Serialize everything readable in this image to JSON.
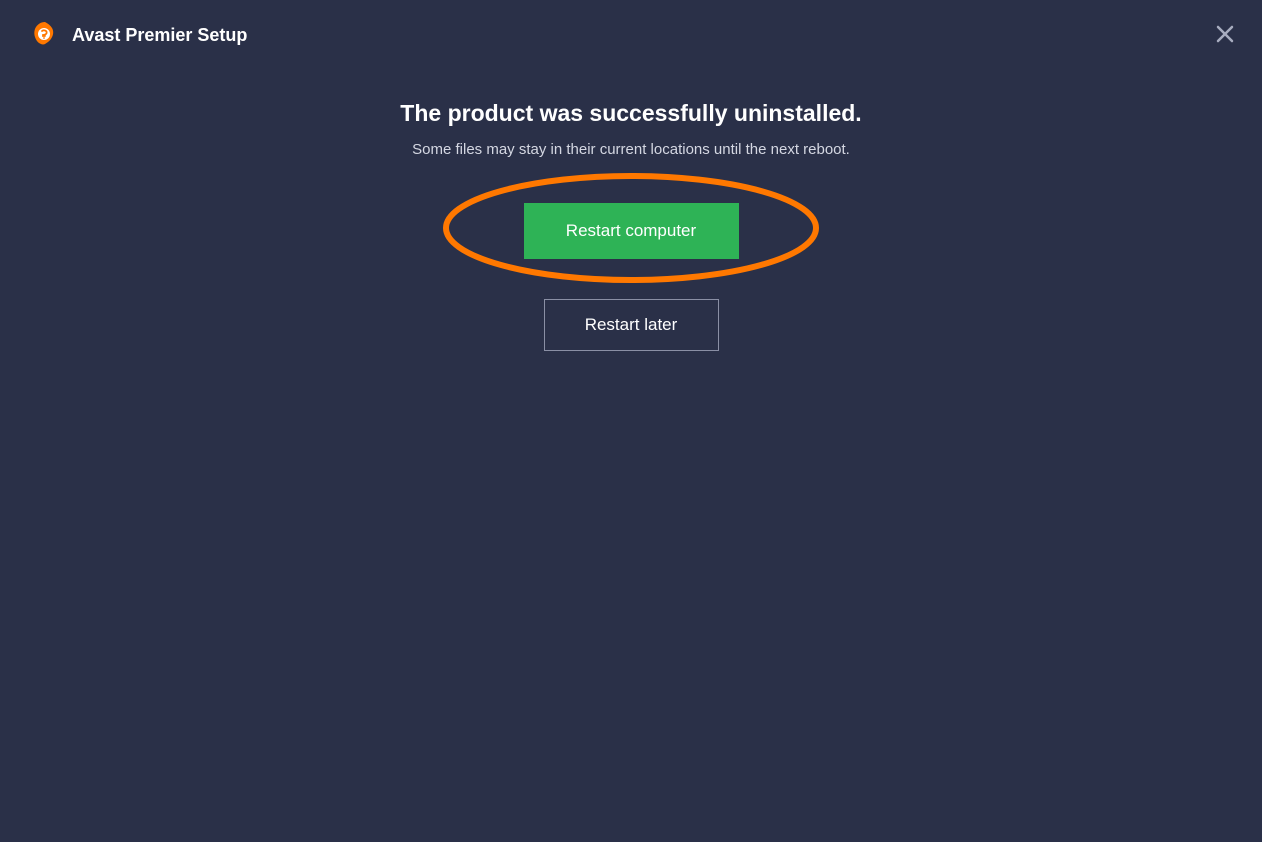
{
  "header": {
    "title": "Avast Premier Setup"
  },
  "main": {
    "heading": "The product was successfully uninstalled.",
    "sub_text": "Some files may stay in their current locations until the next reboot.",
    "primary_button_label": "Restart computer",
    "secondary_button_label": "Restart later"
  },
  "colors": {
    "background": "#2a3048",
    "primary_button": "#2eb356",
    "highlight": "#ff7800",
    "logo": "#ff7800"
  }
}
